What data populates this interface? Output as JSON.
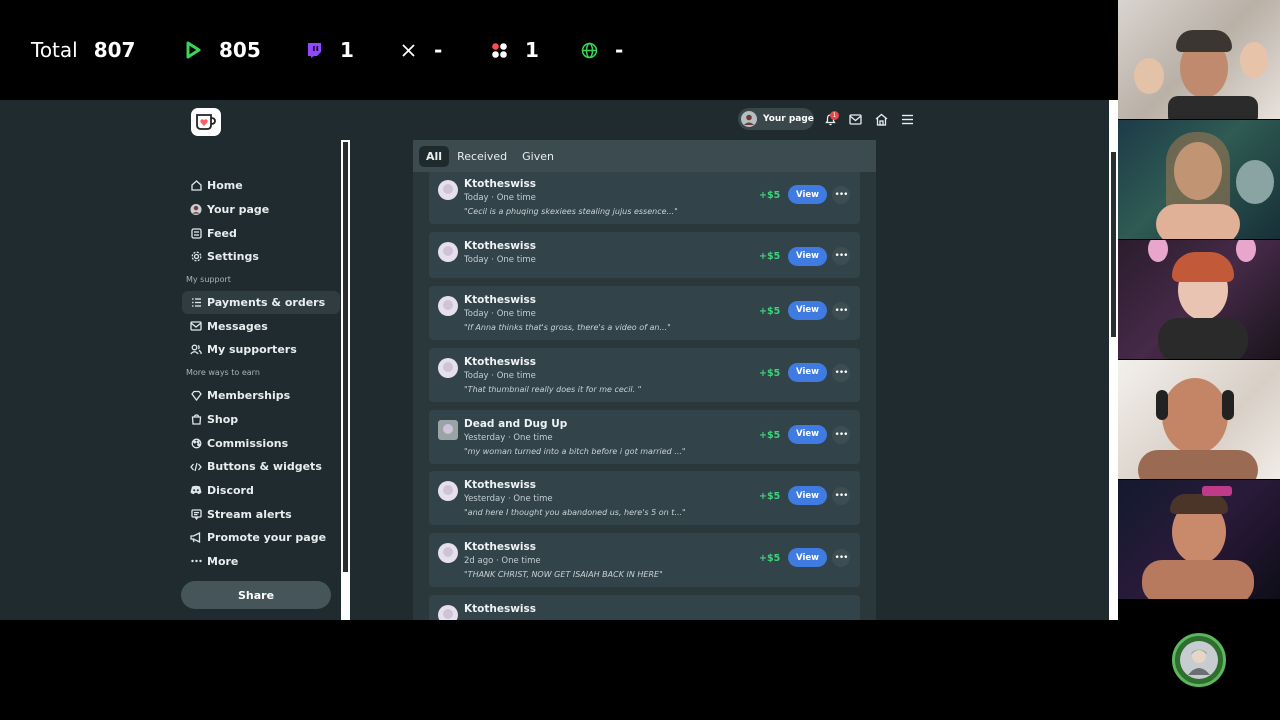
{
  "stats": {
    "total_label": "Total",
    "total_value": "807",
    "youtube_value": "805",
    "twitch_value": "1",
    "x_value": "-",
    "dots_value": "1",
    "web_value": "-",
    "colors": {
      "youtube": "#3bd45a",
      "twitch": "#9146ff",
      "web": "#3bd45a"
    }
  },
  "header": {
    "your_page_label": "Your page",
    "notification_count": "1"
  },
  "sidebar": {
    "items": [
      {
        "label": "Home",
        "icon": "home-icon"
      },
      {
        "label": "Your page",
        "icon": "avatar-icon"
      },
      {
        "label": "Feed",
        "icon": "feed-icon"
      },
      {
        "label": "Settings",
        "icon": "gear-icon"
      }
    ],
    "section_support": "My support",
    "support_items": [
      {
        "label": "Payments & orders",
        "icon": "list-icon",
        "active": true
      },
      {
        "label": "Messages",
        "icon": "mail-icon"
      },
      {
        "label": "My supporters",
        "icon": "users-icon"
      }
    ],
    "section_earn": "More ways to earn",
    "earn_items": [
      {
        "label": "Memberships",
        "icon": "diamond-icon"
      },
      {
        "label": "Shop",
        "icon": "shop-icon"
      },
      {
        "label": "Commissions",
        "icon": "commissions-icon"
      },
      {
        "label": "Buttons & widgets",
        "icon": "code-icon"
      },
      {
        "label": "Discord",
        "icon": "discord-icon"
      },
      {
        "label": "Stream alerts",
        "icon": "alert-icon"
      },
      {
        "label": "Promote your page",
        "icon": "megaphone-icon"
      },
      {
        "label": "More",
        "icon": "ellipsis-icon"
      }
    ],
    "share_label": "Share"
  },
  "tabs": [
    "All",
    "Received",
    "Given"
  ],
  "rows": [
    {
      "name": "Ktotheswiss",
      "meta": "Today · One time",
      "message": "\"Cecil is a phuqing skexiees stealing jujus essence...\"",
      "amount": "+$5",
      "view": "View"
    },
    {
      "name": "Ktotheswiss",
      "meta": "Today · One time",
      "message": "",
      "amount": "+$5",
      "view": "View"
    },
    {
      "name": "Ktotheswiss",
      "meta": "Today · One time",
      "message": "\"If Anna thinks that's gross, there's a video of an...\"",
      "amount": "+$5",
      "view": "View"
    },
    {
      "name": "Ktotheswiss",
      "meta": "Today · One time",
      "message": "\"That thumbnail really does it for me cecil. \"",
      "amount": "+$5",
      "view": "View"
    },
    {
      "name": "Dead and Dug Up",
      "meta": "Yesterday · One time",
      "message": "\"my woman turned into a bitch before i got married ...\"",
      "amount": "+$5",
      "view": "View"
    },
    {
      "name": "Ktotheswiss",
      "meta": "Yesterday · One time",
      "message": "\"and here I thought you abandoned us, here's 5 on t...\"",
      "amount": "+$5",
      "view": "View"
    },
    {
      "name": "Ktotheswiss",
      "meta": "2d ago · One time",
      "message": "\"THANK CHRIST, NOW GET ISAIAH BACK IN HERE\"",
      "amount": "+$5",
      "view": "View"
    },
    {
      "name": "Ktotheswiss",
      "meta": "",
      "message": "",
      "amount": "",
      "view": ""
    }
  ]
}
